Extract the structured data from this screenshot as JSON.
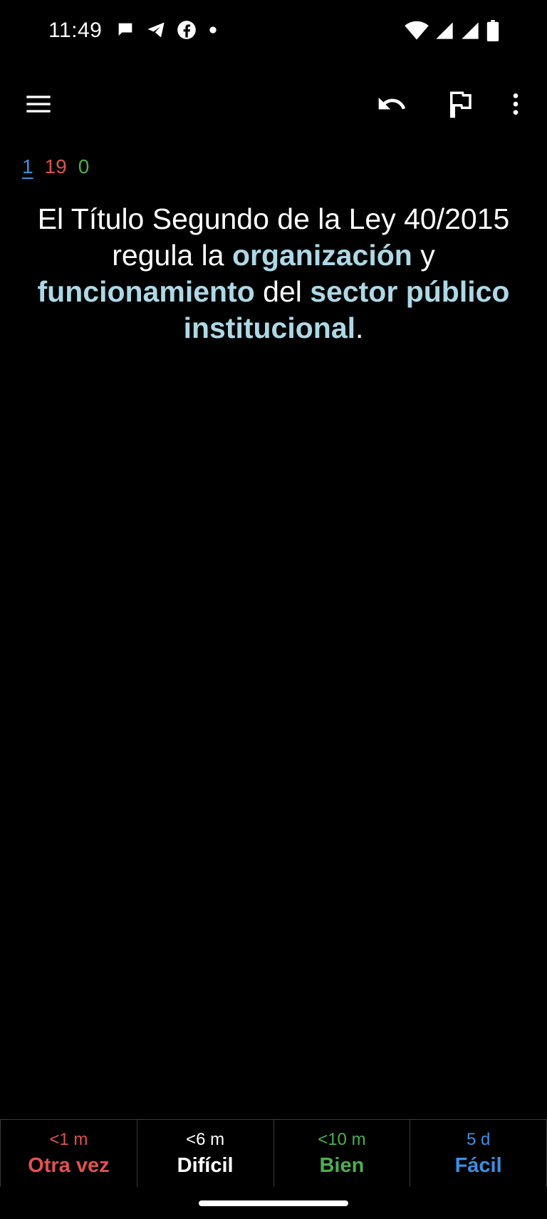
{
  "status_bar": {
    "time": "11:49",
    "left_icons": [
      "chat-bubble-icon",
      "telegram-icon",
      "facebook-icon",
      "dot-icon"
    ],
    "right_icons": [
      "wifi-icon",
      "signal-icon",
      "signal-icon",
      "battery-icon"
    ]
  },
  "toolbar": {
    "icons": [
      "menu-icon",
      "undo-icon",
      "flag-icon",
      "more-vert-icon"
    ]
  },
  "counts": {
    "new": "1",
    "learning": "19",
    "review": "0",
    "colors": {
      "new": "#3d8fe0",
      "learning": "#e0524f",
      "review": "#4caf50"
    }
  },
  "card": {
    "segments": [
      {
        "text": "El Título Segundo de la Ley 40/2015 regula la ",
        "highlight": false
      },
      {
        "text": "organización",
        "highlight": true
      },
      {
        "text": " y ",
        "highlight": false
      },
      {
        "text": "funcionamiento",
        "highlight": true
      },
      {
        "text": " del ",
        "highlight": false
      },
      {
        "text": "sector público institucional",
        "highlight": true
      },
      {
        "text": ".",
        "highlight": false
      }
    ],
    "highlight_color": "#add8e6"
  },
  "answers": [
    {
      "time": "<1 m",
      "label": "Otra vez",
      "color": "#e0524f"
    },
    {
      "time": "<6 m",
      "label": "Difícil",
      "color": "#ffffff"
    },
    {
      "time": "<10 m",
      "label": "Bien",
      "color": "#4caf50"
    },
    {
      "time": "5 d",
      "label": "Fácil",
      "color": "#3d8fe0"
    }
  ]
}
